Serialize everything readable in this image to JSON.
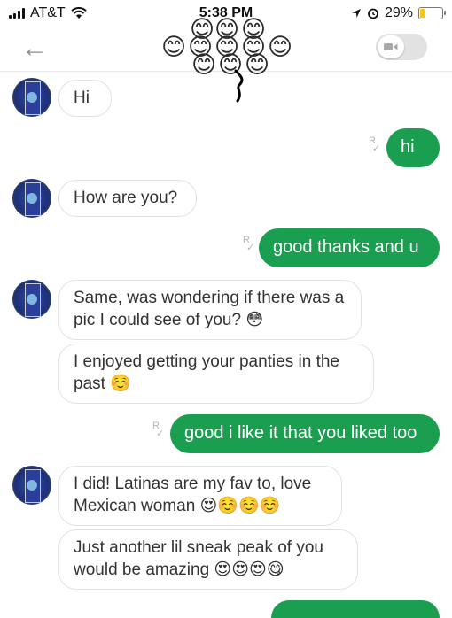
{
  "status_bar": {
    "carrier": "AT&T",
    "time": "5:38 PM",
    "battery_percent": "29%",
    "battery_level": 0.29,
    "battery_color": "#f3c713"
  },
  "header": {
    "back_icon": "back-arrow-icon",
    "overlay_emoji": "😊",
    "video_icon": "video-camera-icon"
  },
  "read_receipt": {
    "letter": "R",
    "check": "✓"
  },
  "messages": [
    {
      "from": "them",
      "text": "Hi"
    },
    {
      "from": "me",
      "text": "hi"
    },
    {
      "from": "them",
      "text": "How are you?"
    },
    {
      "from": "me",
      "text": "good thanks and u"
    },
    {
      "from": "them",
      "text": "Same, was wondering if there was a pic I could see of you? 😳"
    },
    {
      "from": "them",
      "text": "I enjoyed getting your panties in the past ☺️"
    },
    {
      "from": "me",
      "text": "good i like it that you liked too"
    },
    {
      "from": "them",
      "text": "I did! Latinas are my fav to, love Mexican woman 😍☺️☺️☺️"
    },
    {
      "from": "them",
      "text": "Just another lil sneak peak of you would be amazing 😍😍😍😋"
    }
  ],
  "colors": {
    "outgoing_bubble": "#1a9e50",
    "incoming_border": "#e2e2e2"
  }
}
